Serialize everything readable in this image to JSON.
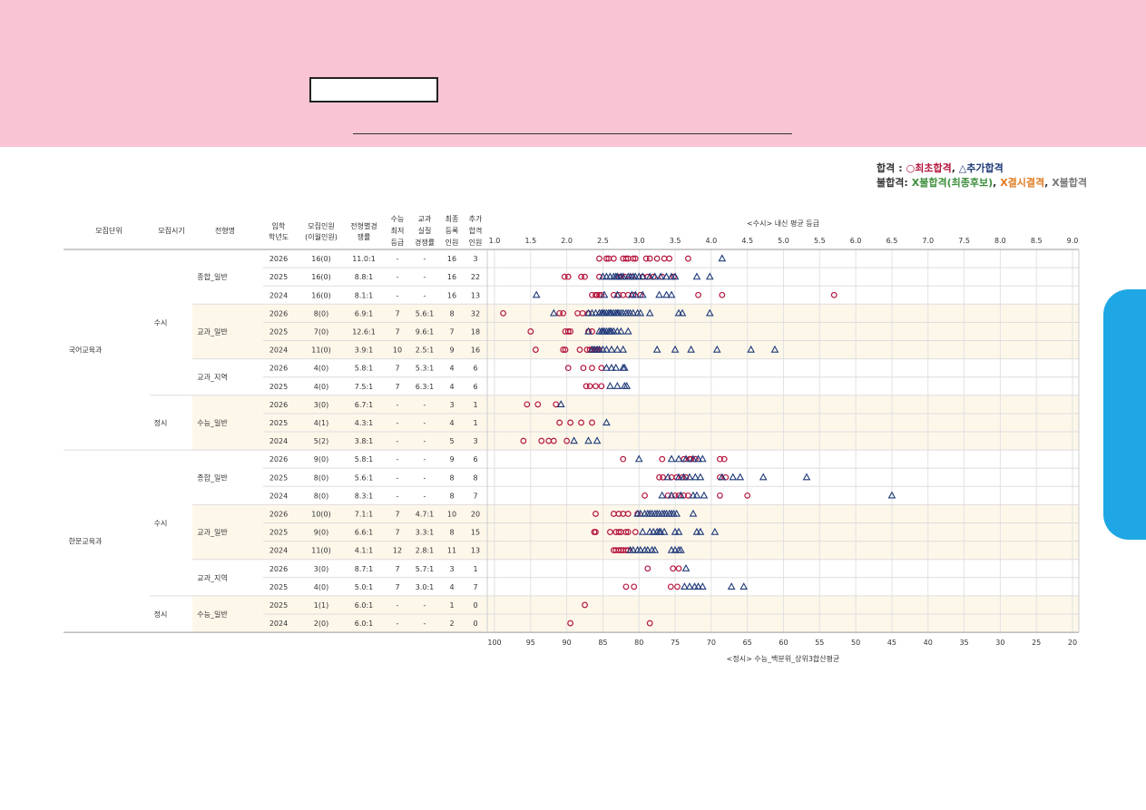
{
  "legend": {
    "pass_label": "합격",
    "pass_sep": " : ",
    "pass_first": "○최초합격",
    "pass_comma": ",",
    "pass_extra": "△추가합격",
    "fail_label": "불합격:",
    "fail_waitlist": "X불합격(최종후보)",
    "fail_comma1": ",",
    "fail_absent": "X결시결격",
    "fail_comma2": ",",
    "fail_plain": "X불합격"
  },
  "table": {
    "headers": {
      "unit": "모집단위",
      "period": "모집시기",
      "type": "전형명",
      "year": [
        "입학",
        "학년도"
      ],
      "quota": [
        "모집인원",
        "(이월인원)"
      ],
      "comp": [
        "전형별경",
        "쟁률"
      ],
      "min": [
        "수능",
        "최저",
        "등급"
      ],
      "real": [
        "교과",
        "실질",
        "경쟁률"
      ],
      "final": [
        "최종",
        "등록",
        "인원"
      ],
      "added": [
        "추가",
        "합격",
        "인원"
      ]
    },
    "units": [
      "국어교육과",
      "한문교육과"
    ],
    "rows": [
      {
        "unit": "국어교육과",
        "period": "수시",
        "type": "종합_일반",
        "year": "2026",
        "quota": "16(0)",
        "comp": "11.0:1",
        "min": "-",
        "real": "-",
        "final": "16",
        "added": "3"
      },
      {
        "unit": "국어교육과",
        "period": "수시",
        "type": "종합_일반",
        "year": "2025",
        "quota": "16(0)",
        "comp": "8.8:1",
        "min": "-",
        "real": "-",
        "final": "16",
        "added": "22"
      },
      {
        "unit": "국어교육과",
        "period": "수시",
        "type": "종합_일반",
        "year": "2024",
        "quota": "16(0)",
        "comp": "8.1:1",
        "min": "-",
        "real": "-",
        "final": "16",
        "added": "13"
      },
      {
        "unit": "국어교육과",
        "period": "수시",
        "type": "교과_일반",
        "year": "2026",
        "quota": "8(0)",
        "comp": "6.9:1",
        "min": "7",
        "real": "5.6:1",
        "final": "8",
        "added": "32"
      },
      {
        "unit": "국어교육과",
        "period": "수시",
        "type": "교과_일반",
        "year": "2025",
        "quota": "7(0)",
        "comp": "12.6:1",
        "min": "7",
        "real": "9.6:1",
        "final": "7",
        "added": "18"
      },
      {
        "unit": "국어교육과",
        "period": "수시",
        "type": "교과_일반",
        "year": "2024",
        "quota": "11(0)",
        "comp": "3.9:1",
        "min": "10",
        "real": "2.5:1",
        "final": "9",
        "added": "16"
      },
      {
        "unit": "국어교육과",
        "period": "수시",
        "type": "교과_지역",
        "year": "2026",
        "quota": "4(0)",
        "comp": "5.8:1",
        "min": "7",
        "real": "5.3:1",
        "final": "4",
        "added": "6"
      },
      {
        "unit": "국어교육과",
        "period": "수시",
        "type": "교과_지역",
        "year": "2025",
        "quota": "4(0)",
        "comp": "7.5:1",
        "min": "7",
        "real": "6.3:1",
        "final": "4",
        "added": "6"
      },
      {
        "unit": "국어교육과",
        "period": "정시",
        "type": "수능_일반",
        "year": "2026",
        "quota": "3(0)",
        "comp": "6.7:1",
        "min": "-",
        "real": "-",
        "final": "3",
        "added": "1"
      },
      {
        "unit": "국어교육과",
        "period": "정시",
        "type": "수능_일반",
        "year": "2025",
        "quota": "4(1)",
        "comp": "4.3:1",
        "min": "-",
        "real": "-",
        "final": "4",
        "added": "1"
      },
      {
        "unit": "국어교육과",
        "period": "정시",
        "type": "수능_일반",
        "year": "2024",
        "quota": "5(2)",
        "comp": "3.8:1",
        "min": "-",
        "real": "-",
        "final": "5",
        "added": "3"
      },
      {
        "unit": "한문교육과",
        "period": "수시",
        "type": "종합_일반",
        "year": "2026",
        "quota": "9(0)",
        "comp": "5.8:1",
        "min": "-",
        "real": "-",
        "final": "9",
        "added": "6"
      },
      {
        "unit": "한문교육과",
        "period": "수시",
        "type": "종합_일반",
        "year": "2025",
        "quota": "8(0)",
        "comp": "5.6:1",
        "min": "-",
        "real": "-",
        "final": "8",
        "added": "8"
      },
      {
        "unit": "한문교육과",
        "period": "수시",
        "type": "종합_일반",
        "year": "2024",
        "quota": "8(0)",
        "comp": "8.3:1",
        "min": "-",
        "real": "-",
        "final": "8",
        "added": "7"
      },
      {
        "unit": "한문교육과",
        "period": "수시",
        "type": "교과_일반",
        "year": "2026",
        "quota": "10(0)",
        "comp": "7.1:1",
        "min": "7",
        "real": "4.7:1",
        "final": "10",
        "added": "20"
      },
      {
        "unit": "한문교육과",
        "period": "수시",
        "type": "교과_일반",
        "year": "2025",
        "quota": "9(0)",
        "comp": "6.6:1",
        "min": "7",
        "real": "3.3:1",
        "final": "8",
        "added": "15"
      },
      {
        "unit": "한문교육과",
        "period": "수시",
        "type": "교과_일반",
        "year": "2024",
        "quota": "11(0)",
        "comp": "4.1:1",
        "min": "12",
        "real": "2.8:1",
        "final": "11",
        "added": "13"
      },
      {
        "unit": "한문교육과",
        "period": "수시",
        "type": "교과_지역",
        "year": "2026",
        "quota": "3(0)",
        "comp": "8.7:1",
        "min": "7",
        "real": "5.7:1",
        "final": "3",
        "added": "1"
      },
      {
        "unit": "한문교육과",
        "period": "수시",
        "type": "교과_지역",
        "year": "2025",
        "quota": "4(0)",
        "comp": "5.0:1",
        "min": "7",
        "real": "3.0:1",
        "final": "4",
        "added": "7"
      },
      {
        "unit": "한문교육과",
        "period": "정시",
        "type": "수능_일반",
        "year": "2025",
        "quota": "1(1)",
        "comp": "6.0:1",
        "min": "-",
        "real": "-",
        "final": "1",
        "added": "0"
      },
      {
        "unit": "한문교육과",
        "period": "정시",
        "type": "수능_일반",
        "year": "2024",
        "quota": "2(0)",
        "comp": "6.0:1",
        "min": "-",
        "real": "-",
        "final": "2",
        "added": "0"
      }
    ]
  },
  "chart_data": {
    "type": "scatter",
    "top_axis_label": "<수시> 내신 평균 등급",
    "top_axis_ticks": [
      "1.0",
      "1.5",
      "2.0",
      "2.5",
      "3.0",
      "3.5",
      "4.0",
      "4.5",
      "5.0",
      "5.5",
      "6.0",
      "6.5",
      "7.0",
      "7.5",
      "8.0",
      "8.5",
      "9.0"
    ],
    "top_axis_range": [
      1.0,
      9.0
    ],
    "bottom_axis_label": "<정시> 수능_백분위_상위3합산평균",
    "bottom_axis_ticks": [
      "100",
      "95",
      "90",
      "85",
      "80",
      "75",
      "70",
      "65",
      "60",
      "55",
      "50",
      "45",
      "40",
      "35",
      "30",
      "25",
      "20"
    ],
    "bottom_axis_range": [
      100,
      20
    ],
    "marker_colors": {
      "first": "#b5173e",
      "extra": "#1f3a7a"
    },
    "rows": [
      {
        "axis": "grade",
        "first": [
          2.45,
          2.55,
          2.58,
          2.65,
          2.78,
          2.82,
          2.85,
          2.92,
          2.95,
          3.1,
          3.15,
          3.25,
          3.35,
          3.42,
          3.68
        ],
        "extra": [
          4.15
        ]
      },
      {
        "axis": "grade",
        "first": [
          1.97,
          2.02,
          2.2,
          2.25,
          2.45,
          2.72,
          2.75,
          2.8,
          2.9,
          3.05,
          3.12,
          3.2,
          3.32,
          3.48
        ],
        "extra": [
          2.5,
          2.55,
          2.6,
          2.65,
          2.68,
          2.7,
          2.75,
          2.78,
          2.85,
          2.88,
          2.92,
          2.95,
          3.0,
          3.05,
          3.15,
          3.22,
          3.3,
          3.38,
          3.45,
          3.5,
          3.8,
          3.98
        ]
      },
      {
        "axis": "grade",
        "first": [
          2.35,
          2.4,
          2.42,
          2.45,
          2.48,
          2.65,
          2.72,
          2.78,
          2.85,
          2.92,
          3.02,
          3.82,
          4.15,
          5.7
        ],
        "extra": [
          1.58,
          2.52,
          2.7,
          2.9,
          2.95,
          3.05,
          3.28,
          3.38,
          3.45
        ]
      },
      {
        "axis": "grade",
        "first": [
          1.12,
          1.9,
          1.95,
          2.15,
          2.22,
          2.3
        ],
        "extra": [
          1.82,
          2.3,
          2.35,
          2.4,
          2.45,
          2.48,
          2.5,
          2.52,
          2.55,
          2.58,
          2.6,
          2.62,
          2.65,
          2.68,
          2.7,
          2.72,
          2.75,
          2.78,
          2.82,
          2.85,
          2.88,
          2.92,
          2.98,
          3.02,
          3.15,
          3.55,
          3.6,
          3.98
        ]
      },
      {
        "axis": "grade",
        "first": [
          1.5,
          1.98,
          2.02,
          2.05,
          2.3,
          2.35
        ],
        "extra": [
          2.3,
          2.45,
          2.48,
          2.5,
          2.52,
          2.55,
          2.58,
          2.6,
          2.62,
          2.65,
          2.7,
          2.75,
          2.85
        ]
      },
      {
        "axis": "grade",
        "first": [
          1.57,
          1.95,
          1.98,
          2.18,
          2.28,
          2.32,
          2.35,
          2.38,
          2.4,
          2.42,
          2.45
        ],
        "extra": [
          2.35,
          2.38,
          2.42,
          2.45,
          2.5,
          2.55,
          2.62,
          2.7,
          2.78,
          3.25,
          3.5,
          3.72,
          4.08,
          4.55,
          4.88
        ]
      },
      {
        "axis": "grade",
        "first": [
          2.02,
          2.23,
          2.35,
          2.48
        ],
        "extra": [
          2.55,
          2.62,
          2.68,
          2.78,
          2.8
        ]
      },
      {
        "axis": "grade",
        "first": [
          2.27,
          2.32,
          2.4,
          2.48
        ],
        "extra": [
          2.6,
          2.7,
          2.8,
          2.83
        ]
      },
      {
        "axis": "percentile",
        "first": [
          95.5,
          94.0,
          91.5
        ],
        "extra": [
          90.8
        ]
      },
      {
        "axis": "percentile",
        "first": [
          91.0,
          89.5,
          88.0,
          86.5
        ],
        "extra": [
          84.5
        ]
      },
      {
        "axis": "percentile",
        "first": [
          96.0,
          93.5,
          92.5,
          91.8,
          90.0
        ],
        "extra": [
          89.0,
          87.0,
          85.8
        ]
      },
      {
        "axis": "grade",
        "first": [
          2.78,
          3.32,
          3.62,
          3.7,
          3.72,
          3.78,
          4.12,
          4.18
        ],
        "extra": [
          3.0,
          3.45,
          3.55,
          3.65,
          3.75,
          3.82,
          3.88
        ]
      },
      {
        "axis": "grade",
        "first": [
          3.28,
          3.33,
          3.45,
          3.52,
          3.6,
          3.65,
          4.12,
          4.2
        ],
        "extra": [
          3.4,
          3.55,
          3.62,
          3.7,
          3.78,
          3.85,
          4.15,
          4.3,
          4.4,
          4.72,
          5.32
        ]
      },
      {
        "axis": "grade",
        "first": [
          3.08,
          3.4,
          3.5,
          3.55,
          3.62,
          3.68,
          4.12,
          4.5
        ],
        "extra": [
          3.32,
          3.45,
          3.58,
          3.75,
          3.8,
          3.9,
          6.5
        ]
      },
      {
        "axis": "grade",
        "first": [
          2.4,
          2.65,
          2.72,
          2.78,
          2.85,
          2.98
        ],
        "extra": [
          2.98,
          3.02,
          3.08,
          3.12,
          3.15,
          3.18,
          3.22,
          3.25,
          3.28,
          3.32,
          3.35,
          3.38,
          3.42,
          3.45,
          3.48,
          3.52,
          3.75
        ]
      },
      {
        "axis": "grade",
        "first": [
          2.38,
          2.4,
          2.6,
          2.68,
          2.72,
          2.75,
          2.82,
          2.85,
          2.95
        ],
        "extra": [
          3.05,
          3.15,
          3.2,
          3.25,
          3.28,
          3.3,
          3.35,
          3.5,
          3.55,
          3.8,
          3.85,
          4.05
        ]
      },
      {
        "axis": "grade",
        "first": [
          2.65,
          2.68,
          2.72,
          2.75,
          2.78,
          2.82,
          2.85
        ],
        "extra": [
          2.88,
          2.92,
          2.98,
          3.02,
          3.08,
          3.12,
          3.18,
          3.22,
          3.45,
          3.5,
          3.55,
          3.58
        ]
      },
      {
        "axis": "grade",
        "first": [
          3.12,
          3.47,
          3.55
        ],
        "extra": [
          3.65
        ]
      },
      {
        "axis": "grade",
        "first": [
          2.82,
          2.93,
          3.44,
          3.53
        ],
        "extra": [
          3.63,
          3.7,
          3.77,
          3.82,
          3.88,
          4.28,
          4.45
        ]
      },
      {
        "axis": "percentile",
        "first": [
          87.5
        ],
        "extra": []
      },
      {
        "axis": "percentile",
        "first": [
          89.5,
          78.5
        ],
        "extra": []
      }
    ]
  }
}
